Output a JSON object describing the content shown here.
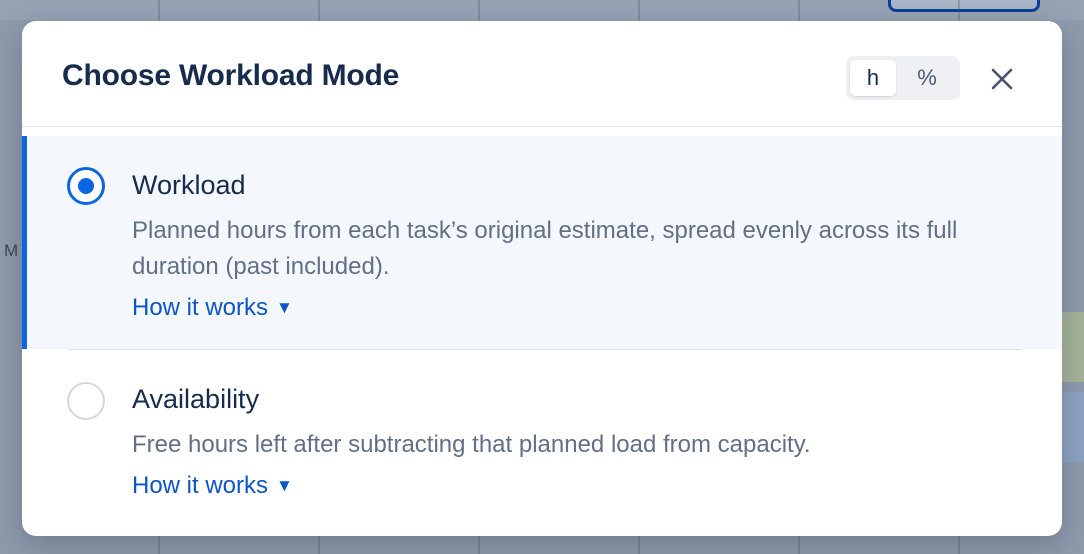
{
  "background": {
    "column_letter": "M"
  },
  "modal": {
    "title": "Choose Workload Mode",
    "unit_toggle": {
      "options": [
        "h",
        "%"
      ],
      "selected": "h"
    },
    "close_icon": "close-icon"
  },
  "options": [
    {
      "title": "Workload",
      "description": "Planned hours from each task’s original estimate, spread evenly across its full duration (past included).",
      "link": "How it works",
      "caret": "▼",
      "selected": true
    },
    {
      "title": "Availability",
      "description": "Free hours left after subtracting that planned load from capacity.",
      "link": "How it works",
      "caret": "▼",
      "selected": false
    }
  ],
  "colors": {
    "accent": "#0c66e4",
    "link": "#0c55c4",
    "title": "#172b4d",
    "muted": "#626f86",
    "selected_bg": "#f4f7fb"
  }
}
